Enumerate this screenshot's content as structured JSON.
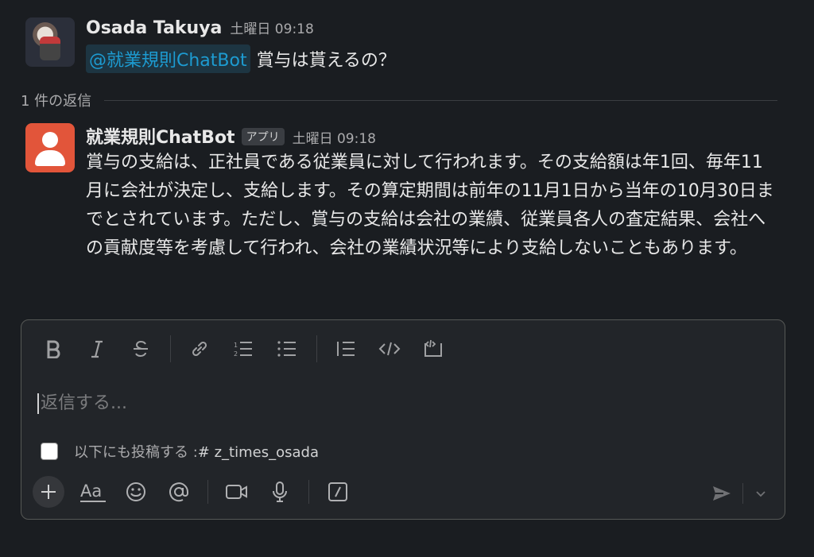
{
  "message": {
    "sender": "Osada Takuya",
    "time": "土曜日 09:18",
    "mention": "@就業規則ChatBot",
    "text": "賞与は貰えるの？"
  },
  "replies_label": "1 件の返信",
  "reply": {
    "sender": "就業規則ChatBot",
    "badge": "アプリ",
    "time": "土曜日 09:18",
    "text": "賞与の支給は、正社員である従業員に対して行われます。その支給額は年1回、毎年11月に会社が決定し、支給します。その算定期間は前年の11月1日から当年の10月30日までとされています。ただし、賞与の支給は会社の業績、従業員各人の査定結果、会社への貢献度等を考慮して行われ、会社の業績状況等により支給しないこともあります。"
  },
  "composer": {
    "placeholder": "返信する...",
    "also_send_label": "以下にも投稿する :",
    "also_send_channel": "# z_times_osada",
    "toolbar_icons": [
      "bold-icon",
      "italic-icon",
      "strikethrough-icon",
      "link-icon",
      "ordered-list-icon",
      "bulleted-list-icon",
      "blockquote-icon",
      "code-icon",
      "code-block-icon"
    ],
    "bottom_icons": [
      "plus-icon",
      "format-icon",
      "emoji-icon",
      "mention-icon",
      "video-icon",
      "microphone-icon",
      "slash-command-icon",
      "send-icon",
      "chevron-down-icon"
    ],
    "format_glyph": "Aa"
  }
}
